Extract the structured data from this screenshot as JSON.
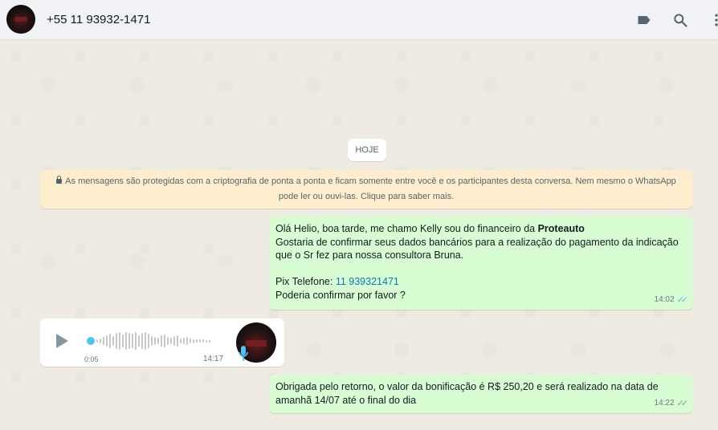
{
  "header": {
    "contact_name": "+55 11 93932-1471",
    "icons": [
      "label-icon",
      "search-icon",
      "more-options-icon"
    ]
  },
  "chat": {
    "day_label": "HOJE",
    "encryption_notice": {
      "line1": "As mensagens são protegidas com a criptografia de ponta a ponta e ficam somente entre você e os participantes desta conversa. Nem mesmo o WhatsApp",
      "line2": "pode ler ou ouvi-las. Clique para saber mais."
    },
    "message1": {
      "greeting_prefix": "Olá Helio, boa tarde, me chamo Kelly  sou do financeiro da ",
      "company": "Proteauto",
      "line2": "Gostaria de confirmar seus dados bancários para a realização do pagamento da indicação",
      "line3": "que o Sr fez para nossa consultora Bruna.",
      "pix_label": "Pix Telefone: ",
      "pix_number": "11 939321471",
      "line5": "Poderia confirmar por favor ?",
      "time": "14:02",
      "status": "read"
    },
    "voice_message": {
      "duration": "0:05",
      "time": "14:17",
      "progress": 0
    },
    "message3": {
      "line1": "Obrigada pelo retorno, o valor da bonificação é R$ 250,20 e será realizado na data de",
      "line2": "amanhã 14/07 até o final do dia",
      "time": "14:22",
      "status": "delivered"
    }
  },
  "colors": {
    "outgoing_bubble": "#d9fdd3",
    "incoming_bubble": "#ffffff",
    "system_notice": "#ffeecd",
    "read_ticks": "#53bdeb",
    "link": "#027eb5"
  }
}
